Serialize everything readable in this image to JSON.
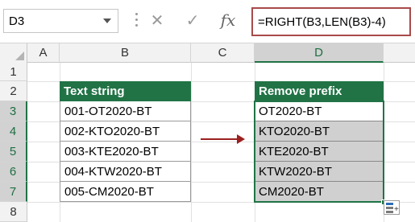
{
  "formula_bar": {
    "name_box": "D3",
    "cancel_glyph": "✕",
    "enter_glyph": "✓",
    "fx_label": "fx",
    "formula": "=RIGHT(B3,LEN(B3)-4)"
  },
  "columns": [
    "A",
    "B",
    "C",
    "D"
  ],
  "rows": [
    "1",
    "2",
    "3",
    "4",
    "5",
    "6",
    "7",
    "8"
  ],
  "source_table": {
    "header": "Text string",
    "values": [
      "001-OT2020-BT",
      "002-KTO2020-BT",
      "003-KTE2020-BT",
      "004-KTW2020-BT",
      "005-CM2020-BT"
    ]
  },
  "result_table": {
    "header": "Remove prefix",
    "values": [
      "OT2020-BT",
      "KTO2020-BT",
      "KTE2020-BT",
      "KTW2020-BT",
      "CM2020-BT"
    ]
  },
  "colors": {
    "header_green": "#217346",
    "arrow_red": "#9b2020",
    "formula_border": "#a94a4a",
    "selection_fill": "#d0d0d0"
  },
  "icons": [
    "chevron-down-icon",
    "cancel-icon",
    "enter-icon",
    "fx-icon",
    "quick-analysis-icon"
  ]
}
